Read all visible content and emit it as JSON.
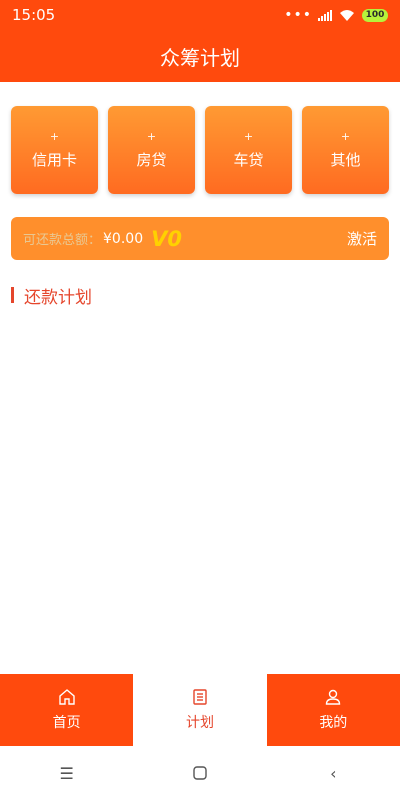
{
  "status_bar": {
    "time": "15:05",
    "dots": "•••",
    "battery": "100"
  },
  "header": {
    "title": "众筹计划"
  },
  "tiles": [
    {
      "plus": "+",
      "label": "信用卡"
    },
    {
      "plus": "+",
      "label": "房贷"
    },
    {
      "plus": "+",
      "label": "车贷"
    },
    {
      "plus": "+",
      "label": "其他"
    }
  ],
  "balance": {
    "label": "可还款总额：",
    "amount": "¥0.00",
    "vip": "V0",
    "action": "激活"
  },
  "section": {
    "title": "还款计划"
  },
  "bottom_nav": [
    {
      "label": "首页",
      "icon": "home-icon"
    },
    {
      "label": "计划",
      "icon": "list-icon",
      "active": true
    },
    {
      "label": "我的",
      "icon": "user-icon"
    }
  ],
  "system_nav": {
    "menu": "☰",
    "back": "‹"
  },
  "colors": {
    "primary": "#ff4a0d",
    "tile": "#ff7a26",
    "accent": "#e5462c",
    "vip": "#ffd100"
  }
}
